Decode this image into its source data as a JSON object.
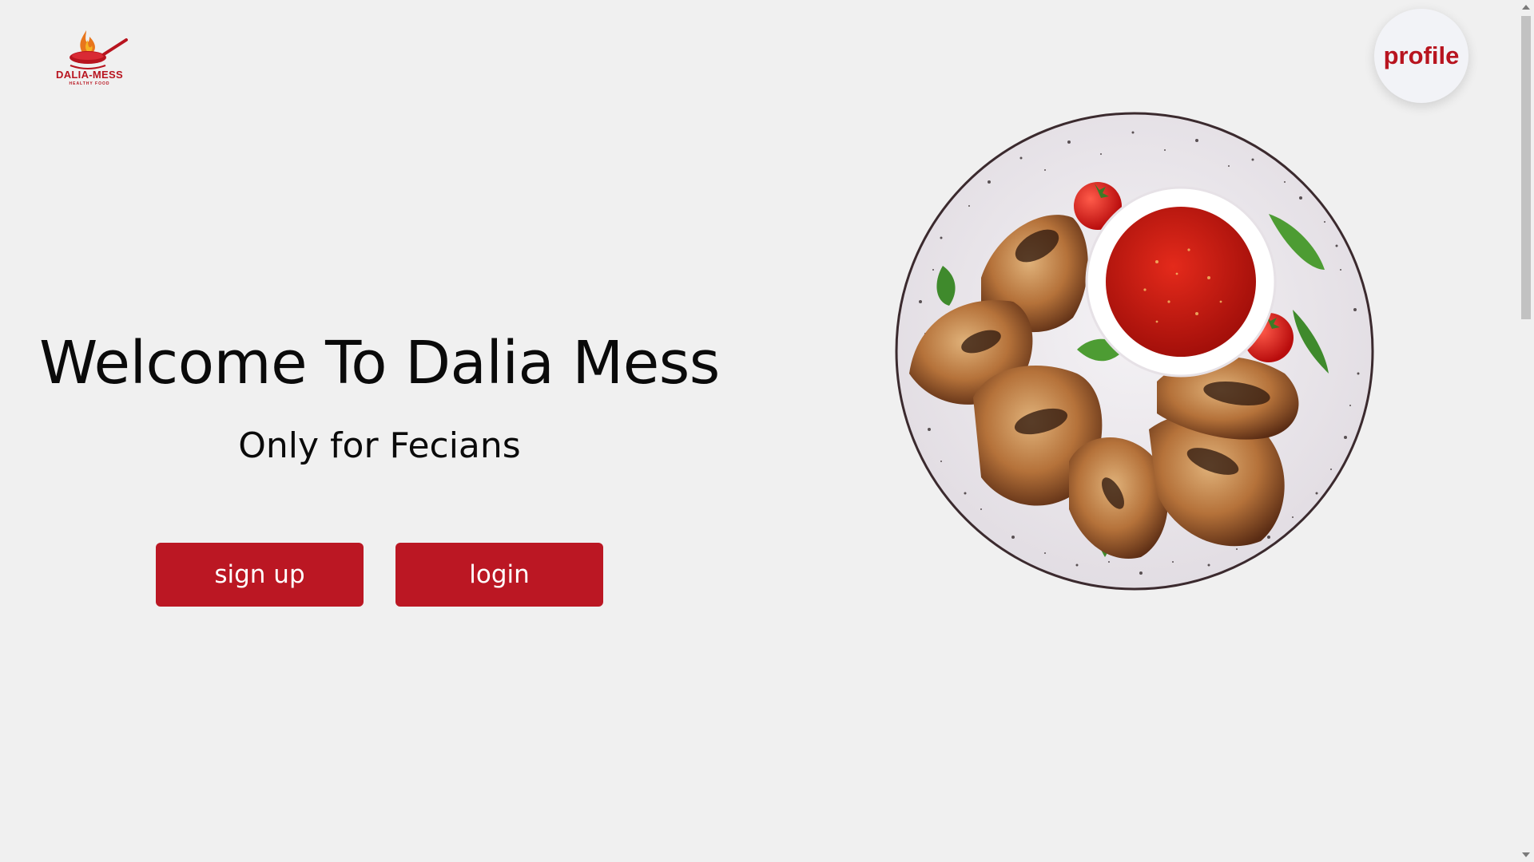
{
  "logo": {
    "name": "DALIA-MESS",
    "tagline": "HEALTHY FOOD",
    "icon": "flaming-pan-logo"
  },
  "header": {
    "profile_label": "profile"
  },
  "hero": {
    "title": "Welcome To Dalia Mess",
    "subtitle": "Only for Fecians",
    "signup_label": "sign up",
    "login_label": "login",
    "image": "grilled-chicken-wings-plate"
  },
  "colors": {
    "brand": "#bb1723",
    "background": "#f0f0f0",
    "profile_bg": "#f2f3f7"
  }
}
